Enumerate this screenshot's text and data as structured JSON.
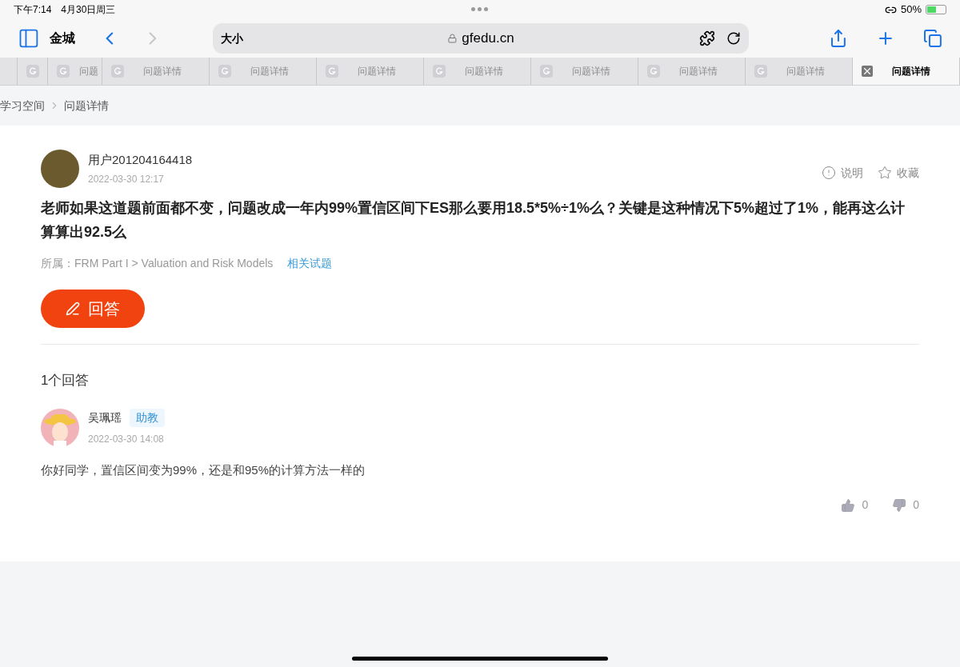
{
  "status_bar": {
    "time": "下午7:14",
    "date": "4月30日周三",
    "battery": "50%"
  },
  "toolbar": {
    "tab_group": "金城",
    "address_prefix": "大小",
    "url": "gfedu.cn"
  },
  "tabs": [
    {
      "selected": false
    },
    {
      "label": "问题",
      "selected": false
    },
    {
      "label": "问题详情",
      "selected": false
    },
    {
      "label": "问题详情",
      "selected": false
    },
    {
      "label": "问题详情",
      "selected": false
    },
    {
      "label": "问题详情",
      "selected": false
    },
    {
      "label": "问题详情",
      "selected": false
    },
    {
      "label": "问题详情",
      "selected": false
    },
    {
      "label": "问题详情",
      "selected": false
    },
    {
      "label": "问题详情",
      "selected": true
    }
  ],
  "breadcrumb": [
    "学习空间",
    "问题详情"
  ],
  "question": {
    "user": "用户201204164418",
    "time": "2022-03-30 12:17",
    "actions": [
      "说明",
      "收藏"
    ],
    "text": "老师如果这道题前面都不变，问题改成一年内99%置信区间下ES那么要用18.5*5%÷1%么？关键是这种情况下5%超过了1%，能再这么计算算出92.5么",
    "category": "所属：FRM Part I > Valuation and Risk Models",
    "related_link": "相关试题",
    "answer_button": "回答"
  },
  "answers_count": "1个回答",
  "answers": [
    {
      "user": "吴珮瑶",
      "badge": "助教",
      "time": "2022-03-30 14:08",
      "text": "你好同学，置信区间变为99%，还是和95%的计算方法一样的",
      "likes": "0",
      "dislikes": "0"
    }
  ]
}
